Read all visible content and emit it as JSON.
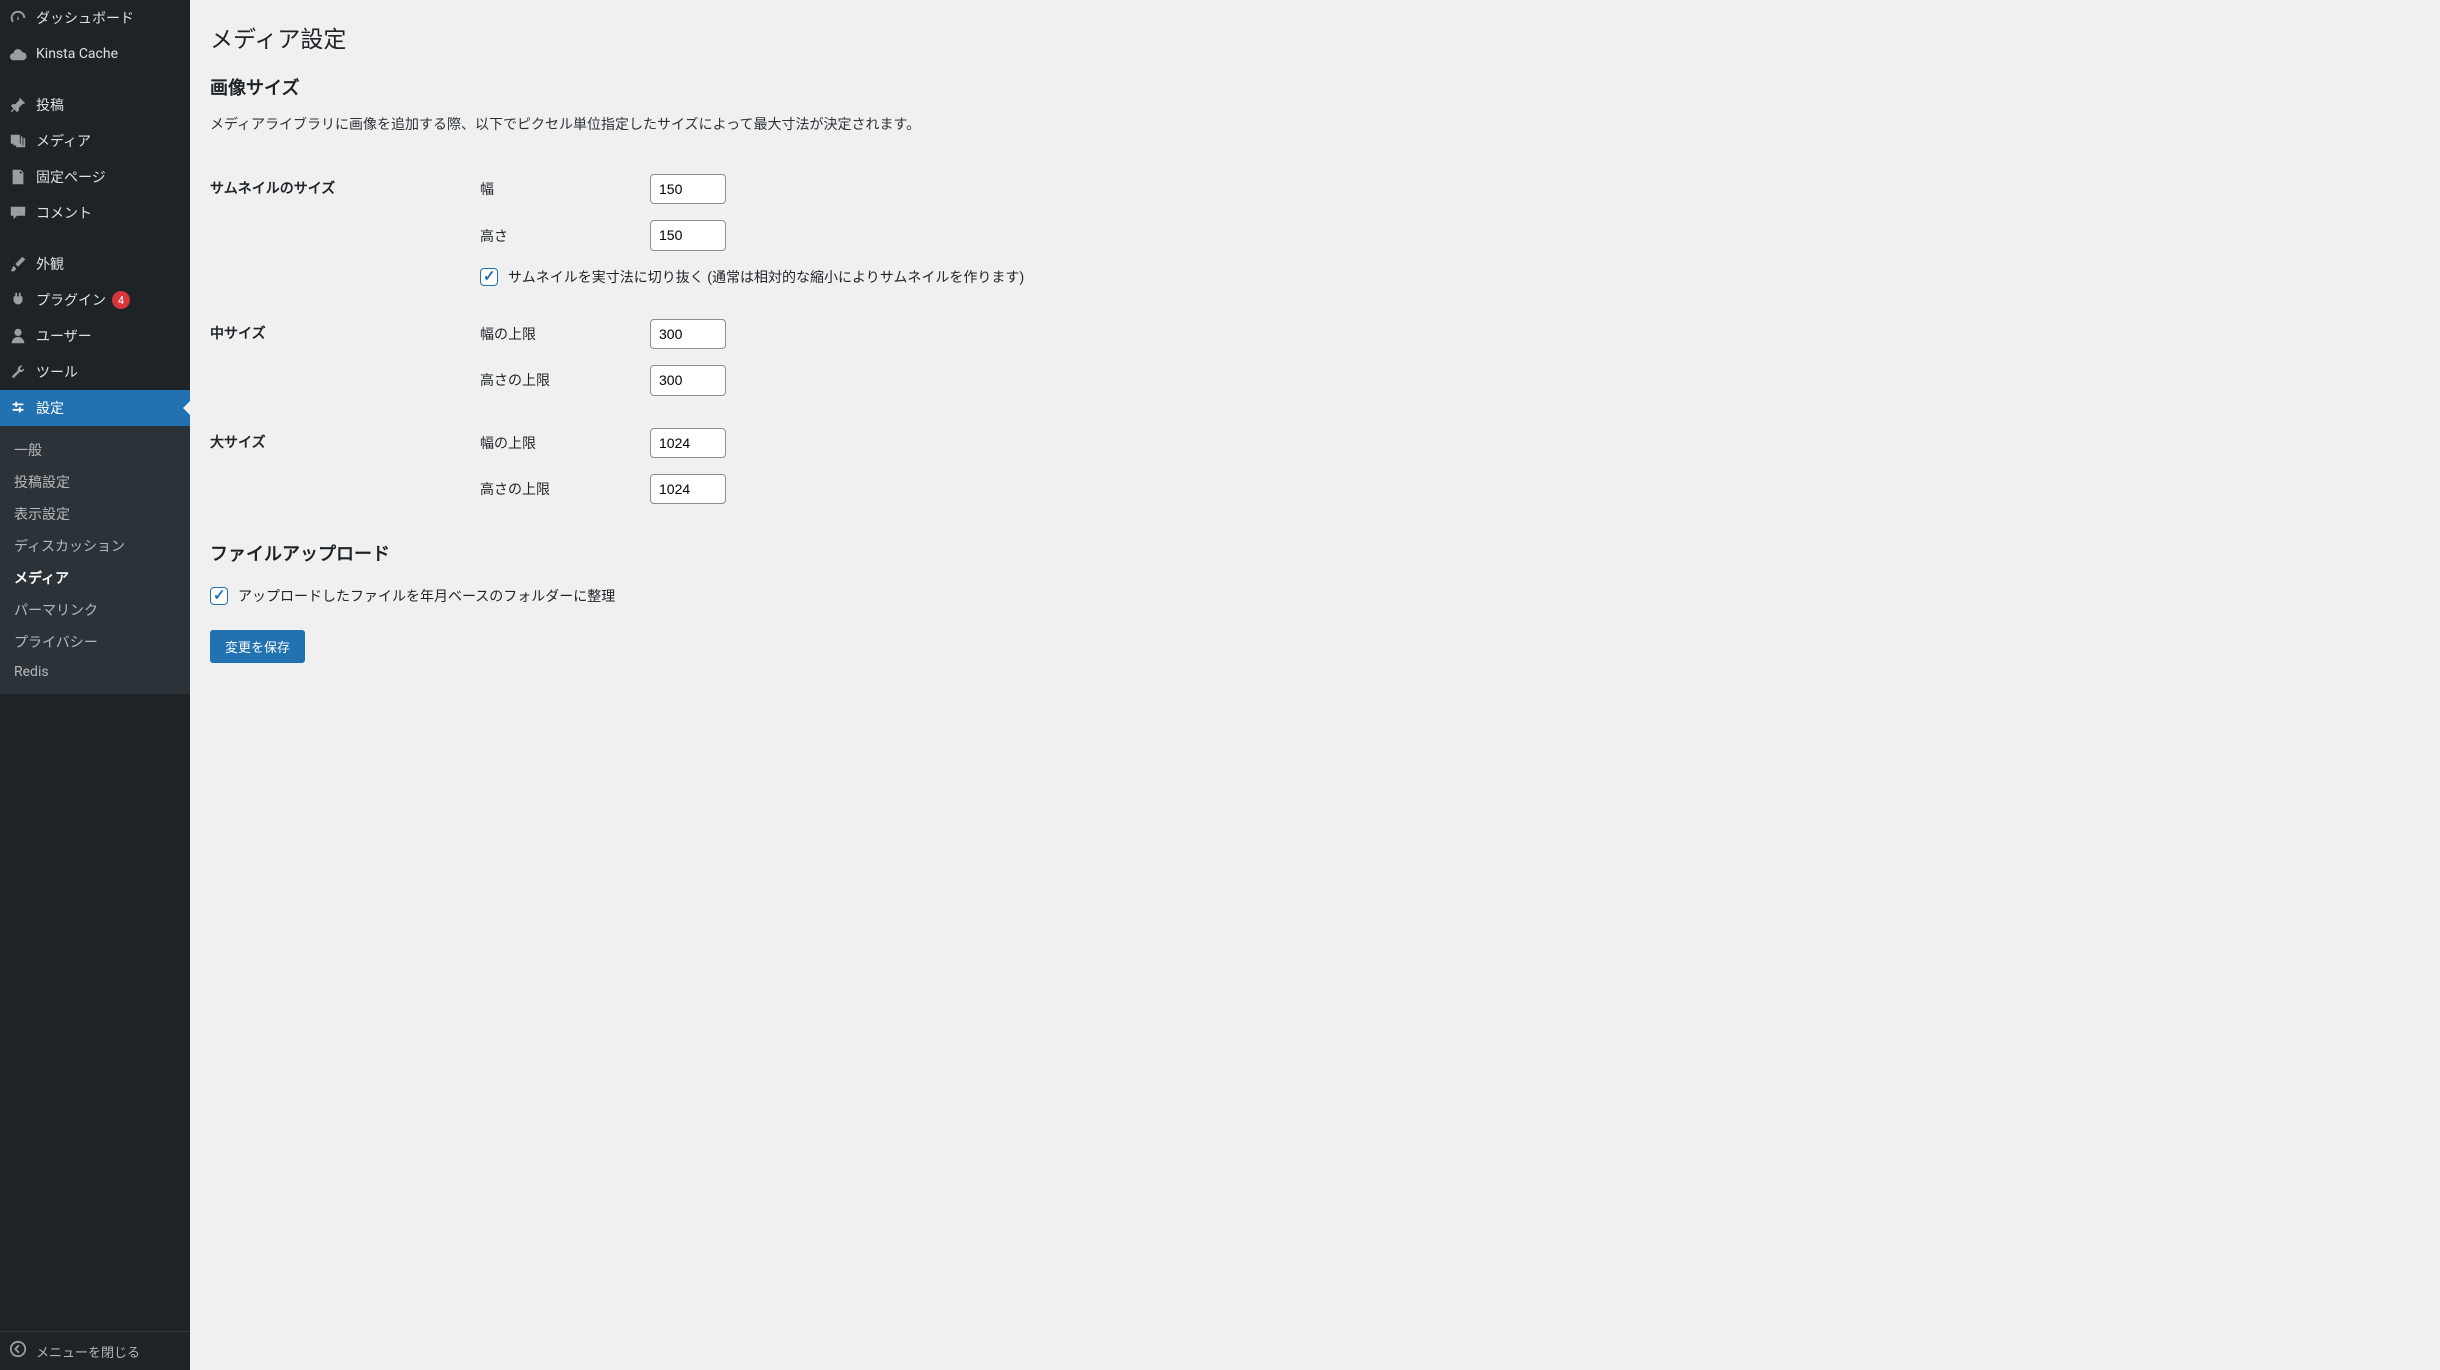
{
  "sidebar": {
    "items": [
      {
        "label": "ダッシュボード",
        "icon": "dashboard"
      },
      {
        "label": "Kinsta Cache",
        "icon": "cloud"
      },
      {
        "label": "投稿",
        "icon": "pin"
      },
      {
        "label": "メディア",
        "icon": "media"
      },
      {
        "label": "固定ページ",
        "icon": "page"
      },
      {
        "label": "コメント",
        "icon": "comment"
      },
      {
        "label": "外観",
        "icon": "brush"
      },
      {
        "label": "プラグイン",
        "icon": "plugin",
        "badge": "4"
      },
      {
        "label": "ユーザー",
        "icon": "user"
      },
      {
        "label": "ツール",
        "icon": "wrench"
      },
      {
        "label": "設定",
        "icon": "settings",
        "active": true
      }
    ],
    "submenu": [
      "一般",
      "投稿設定",
      "表示設定",
      "ディスカッション",
      "メディア",
      "パーマリンク",
      "プライバシー",
      "Redis"
    ],
    "submenu_current": "メディア",
    "collapse_label": "メニューを閉じる"
  },
  "page": {
    "title": "メディア設定",
    "section_image_sizes": "画像サイズ",
    "image_sizes_desc": "メディアライブラリに画像を追加する際、以下でピクセル単位指定したサイズによって最大寸法が決定されます。",
    "thumbnail": {
      "heading": "サムネイルのサイズ",
      "width_label": "幅",
      "width_value": "150",
      "height_label": "高さ",
      "height_value": "150",
      "crop_label": "サムネイルを実寸法に切り抜く (通常は相対的な縮小によりサムネイルを作ります)"
    },
    "medium": {
      "heading": "中サイズ",
      "width_label": "幅の上限",
      "width_value": "300",
      "height_label": "高さの上限",
      "height_value": "300"
    },
    "large": {
      "heading": "大サイズ",
      "width_label": "幅の上限",
      "width_value": "1024",
      "height_label": "高さの上限",
      "height_value": "1024"
    },
    "section_upload": "ファイルアップロード",
    "organize_label": "アップロードしたファイルを年月ベースのフォルダーに整理",
    "save_button": "変更を保存"
  }
}
